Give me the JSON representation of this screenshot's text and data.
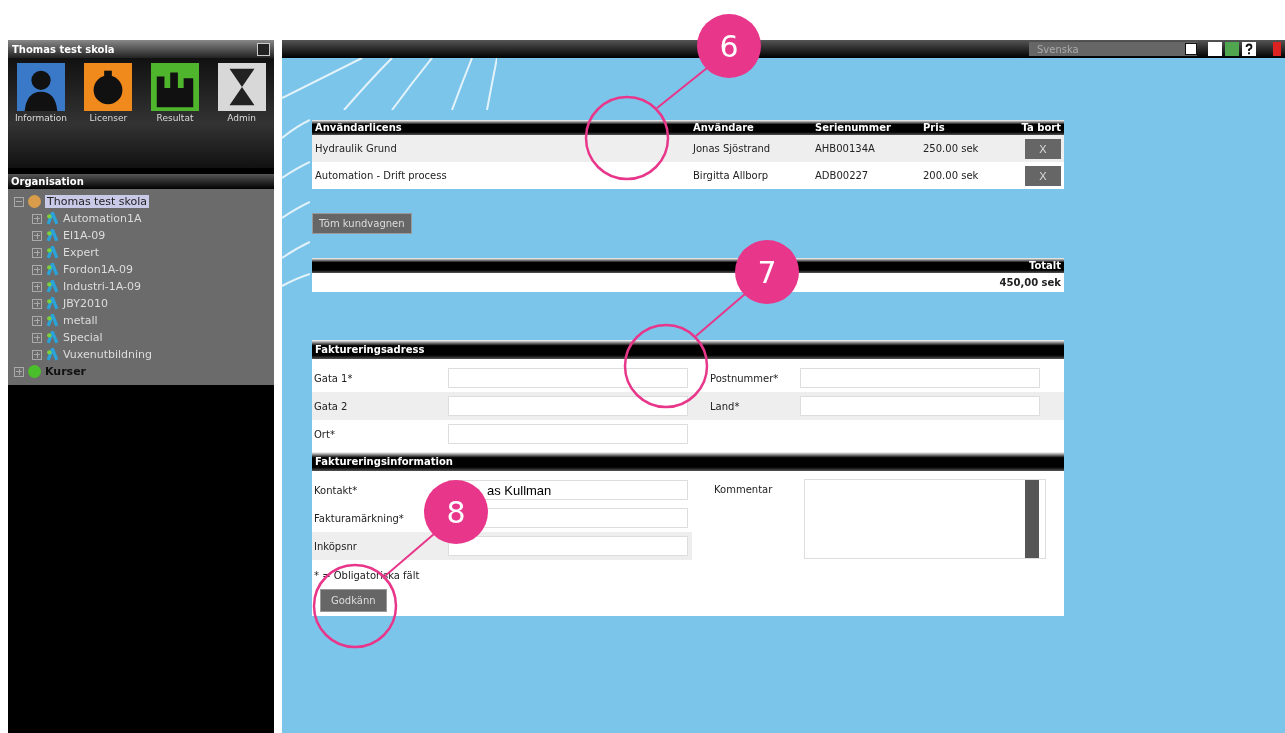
{
  "sidebar": {
    "title": "Thomas test skola",
    "modules": [
      {
        "label": "Information",
        "kind": "info"
      },
      {
        "label": "Licenser",
        "kind": "license"
      },
      {
        "label": "Resultat",
        "kind": "result"
      },
      {
        "label": "Admin",
        "kind": "admin"
      }
    ],
    "organisation": {
      "title": "Organisation",
      "tree": [
        {
          "label": "Thomas test skola",
          "kind": "school",
          "selected": true,
          "expanded": true,
          "children": [
            {
              "label": "Automation1A",
              "kind": "group",
              "selected": false
            },
            {
              "label": "El1A-09",
              "kind": "group",
              "selected": false
            },
            {
              "label": "Expert",
              "kind": "group",
              "selected": false
            },
            {
              "label": "Fordon1A-09",
              "kind": "group",
              "selected": false
            },
            {
              "label": "Industri-1A-09",
              "kind": "group",
              "selected": false
            },
            {
              "label": "JBY2010",
              "kind": "group",
              "selected": false
            },
            {
              "label": "metall",
              "kind": "group",
              "selected": false
            },
            {
              "label": "Special",
              "kind": "group",
              "selected": false
            },
            {
              "label": "Vuxenutbildning",
              "kind": "group",
              "selected": false
            }
          ]
        },
        {
          "label": "Kurser",
          "kind": "courses",
          "selected": false,
          "expanded": false
        }
      ]
    }
  },
  "topbar": {
    "language": "Svenska"
  },
  "cart": {
    "columns": [
      "Användarlicens",
      "Användare",
      "Serienummer",
      "Pris",
      "Ta bort"
    ],
    "rows": [
      {
        "license": "Hydraulik Grund",
        "user": "Jonas Sjöstrand",
        "serial": "AHB00134A",
        "price": "250.00 sek",
        "remove": "X"
      },
      {
        "license": "Automation - Drift process",
        "user": "Birgitta Allborp",
        "serial": "ADB00227",
        "price": "200.00 sek",
        "remove": "X"
      }
    ],
    "empty_button": "Töm kundvagnen"
  },
  "total": {
    "label": "Totalt",
    "value": "450,00 sek"
  },
  "billing_address": {
    "title": "Faktureringsadress",
    "fields": [
      {
        "label": "Gata 1*"
      },
      {
        "label": "Postnummer*"
      },
      {
        "label": "Gata 2"
      },
      {
        "label": "Land*"
      },
      {
        "label": "Ort*"
      }
    ]
  },
  "billing_info": {
    "title": "Faktureringsinformation",
    "contact": {
      "label": "Kontakt*",
      "value": "as Kullman"
    },
    "invoice_mark": {
      "label": "Fakturamärkning*"
    },
    "order_no": {
      "label": "Inköpsnr"
    },
    "comment": {
      "label": "Kommentar"
    },
    "required_note": "* = Obligatoriska fält",
    "submit": "Godkänn"
  },
  "callouts": [
    {
      "number": "6"
    },
    {
      "number": "7"
    },
    {
      "number": "8"
    }
  ]
}
